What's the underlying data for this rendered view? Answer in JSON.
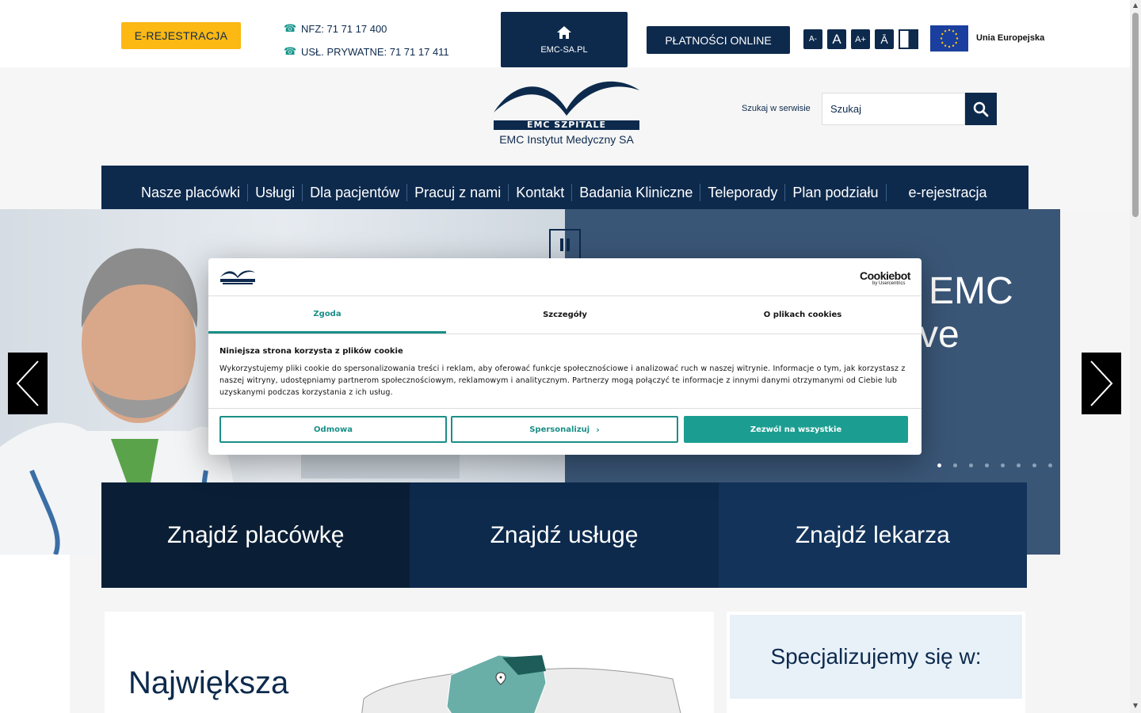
{
  "topbar": {
    "ereg_label": "E-REJESTRACJA",
    "phone_nfz": "NFZ: 71 71 17 400",
    "phone_private": "USŁ. PRYWATNE: 71 71 17 411",
    "home_label": "EMC-SA.PL",
    "pay_label": "PŁATNOŚCI ONLINE",
    "font_small": "A-",
    "font_normal": "A",
    "font_large": "A+",
    "font_contrast": "Ā",
    "eu_label": "Unia Europejska"
  },
  "header": {
    "logo_band": "EMC SZPITALE",
    "logo_sub": "EMC Instytut Medyczny SA",
    "search_label": "Szukaj w serwisie",
    "search_placeholder": "Szukaj"
  },
  "nav": {
    "items": [
      "Nasze placówki",
      "Usługi",
      "Dla pacjentów",
      "Pracuj z nami",
      "Kontakt",
      "Badania Kliniczne",
      "Teleporady",
      "Plan podziału",
      "e-rejestracja"
    ]
  },
  "hero": {
    "text_line1": "EMC",
    "text_line2": "ve"
  },
  "tiles": {
    "facility": "Znajdź placówkę",
    "service": "Znajdź usługę",
    "doctor": "Znajdź lekarza"
  },
  "content": {
    "left_heading": "Największa",
    "right_heading": "Specjalizujemy się w:"
  },
  "cookie": {
    "brand": "Cookiebot",
    "brand_sub": "by Usercentrics",
    "tabs": [
      "Zgoda",
      "Szczegóły",
      "O plikach cookies"
    ],
    "title": "Niniejsza strona korzysta z plików cookie",
    "body": "Wykorzystujemy pliki cookie do spersonalizowania treści i reklam, aby oferować funkcje społecznościowe i analizować ruch w naszej witrynie. Informacje o tym, jak korzystasz z naszej witryny, udostępniamy partnerom społecznościowym, reklamowym i analitycznym. Partnerzy mogą połączyć te informacje z innymi danymi otrzymanymi od Ciebie lub uzyskanymi podczas korzystania z ich usług.",
    "deny": "Odmowa",
    "customize": "Spersonalizuj",
    "allow": "Zezwól na wszystkie"
  },
  "colors": {
    "navy": "#0d2a4d",
    "accent_yellow": "#fcb813",
    "teal": "#1b9e91"
  }
}
